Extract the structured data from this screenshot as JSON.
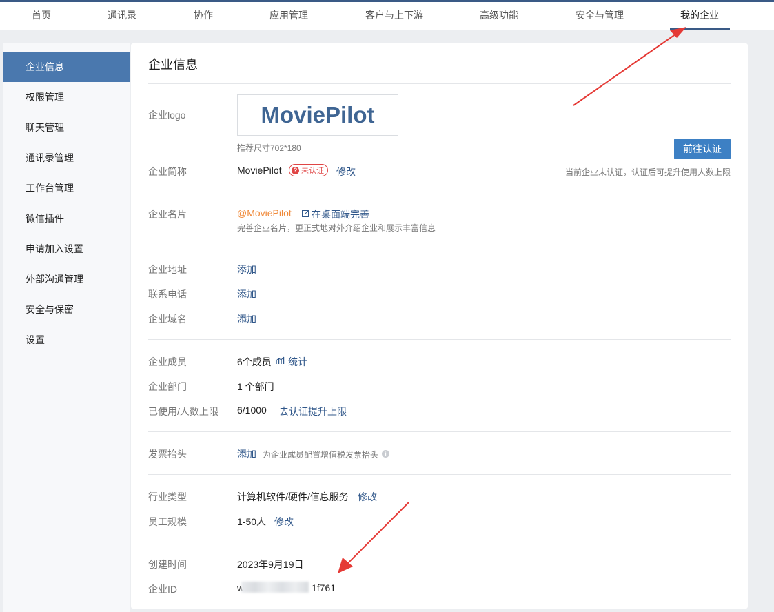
{
  "nav": {
    "items": [
      "首页",
      "通讯录",
      "协作",
      "应用管理",
      "客户与上下游",
      "高级功能",
      "安全与管理",
      "我的企业"
    ],
    "active_index": 7
  },
  "sidebar": {
    "items": [
      "企业信息",
      "权限管理",
      "聊天管理",
      "通讯录管理",
      "工作台管理",
      "微信插件",
      "申请加入设置",
      "外部沟通管理",
      "安全与保密",
      "设置"
    ],
    "active_index": 0
  },
  "page": {
    "title": "企业信息"
  },
  "logo": {
    "label": "企业logo",
    "text": "MoviePilot",
    "hint": "推荐尺寸702*180"
  },
  "verify": {
    "button": "前往认证",
    "note": "当前企业未认证，认证后可提升使用人数上限"
  },
  "short_name": {
    "label": "企业简称",
    "value": "MoviePilot",
    "badge": "未认证",
    "badge_icon": "?",
    "edit": "修改"
  },
  "card": {
    "label": "企业名片",
    "handle": "@MoviePilot",
    "link": "在桌面端完善",
    "desc": "完善企业名片，更正式地对外介绍企业和展示丰富信息"
  },
  "address": {
    "label": "企业地址",
    "action": "添加"
  },
  "phone": {
    "label": "联系电话",
    "action": "添加"
  },
  "domain": {
    "label": "企业域名",
    "action": "添加"
  },
  "members": {
    "label": "企业成员",
    "value": "6个成员",
    "link": "统计"
  },
  "depts": {
    "label": "企业部门",
    "value": "1 个部门"
  },
  "usage": {
    "label": "已使用/人数上限",
    "value": "6/1000",
    "link": "去认证提升上限"
  },
  "invoice": {
    "label": "发票抬头",
    "action": "添加",
    "desc": "为企业成员配置增值税发票抬头",
    "info_icon": "i"
  },
  "industry": {
    "label": "行业类型",
    "value": "计算机软件/硬件/信息服务",
    "edit": "修改"
  },
  "scale": {
    "label": "员工规模",
    "value": "1-50人",
    "edit": "修改"
  },
  "created": {
    "label": "创建时间",
    "value": "2023年9月19日"
  },
  "corp_id": {
    "label": "企业ID",
    "prefix": "w",
    "suffix": "1f761"
  },
  "colors": {
    "accent": "#4a78ae",
    "link": "#30578a",
    "arrow": "#e53935",
    "orange": "#f08a3a"
  }
}
